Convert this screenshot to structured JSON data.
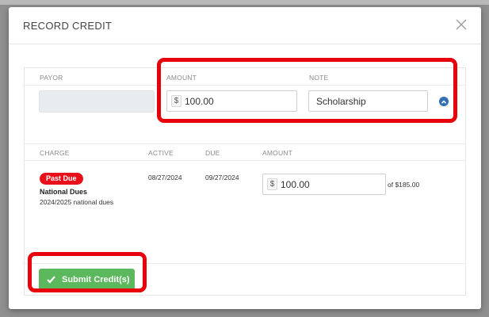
{
  "modal": {
    "title": "RECORD CREDIT"
  },
  "payor_section": {
    "headers": {
      "payor": "PAYOR",
      "amount": "AMOUNT",
      "note": "NOTE"
    },
    "amount": {
      "currency_symbol": "$",
      "value": "100.00"
    },
    "note": {
      "value": "Scholarship"
    }
  },
  "charges": {
    "headers": {
      "charge": "CHARGE",
      "active": "ACTIVE",
      "due": "DUE",
      "amount": "AMOUNT"
    },
    "rows": [
      {
        "status": "Past Due",
        "name": "National Dues",
        "description": "2024/2025 national dues",
        "active": "08/27/2024",
        "due": "09/27/2024",
        "currency_symbol": "$",
        "amount": "100.00",
        "of_total": "of $185.00"
      }
    ]
  },
  "footer": {
    "submit_label": "Submit Credit(s)"
  },
  "colors": {
    "highlight_red": "#e8000b",
    "badge_red": "#e8111b",
    "submit_green": "#5cb85c",
    "collapse_blue": "#2f6fb3"
  },
  "icons": {
    "close": "close-icon",
    "collapse": "chevron-up-circle-icon",
    "check": "check-icon"
  }
}
